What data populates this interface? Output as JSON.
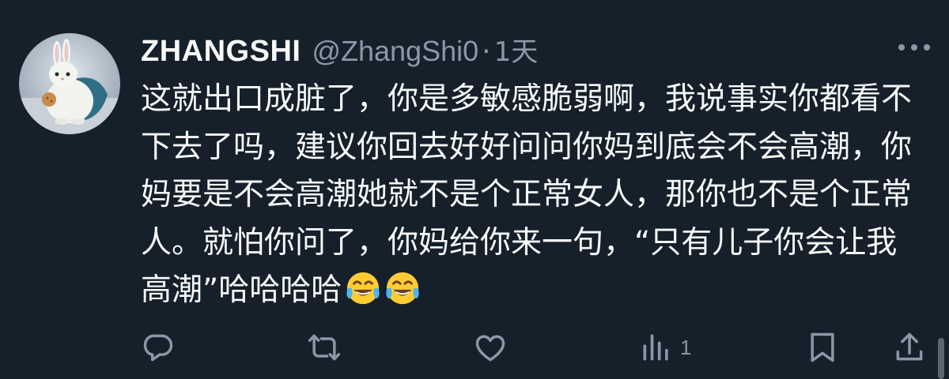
{
  "tweet": {
    "display_name": "ZHANGSHI",
    "handle": "@ZhangShi0",
    "separator": "·",
    "time": "1天",
    "text": "这就出口成脏了，你是多敏感脆弱啊，我说事实你都看不下去了吗，建议你回去好好问问你妈到底会不会高潮，你妈要是不会高潮她就不是个正常女人，那你也不是个正常人。就怕你问了，你妈给你来一句，“只有儿子你会让我高潮”哈哈哈哈",
    "emojis": [
      "face-with-tears-of-joy",
      "face-with-tears-of-joy"
    ],
    "actions": {
      "reply_icon": "reply-icon",
      "retweet_icon": "retweet-icon",
      "like_icon": "like-icon",
      "views_icon": "views-icon",
      "views_count": "1",
      "bookmark_icon": "bookmark-icon",
      "share_icon": "share-icon"
    }
  },
  "colors": {
    "background": "#15202b",
    "text": "#f7f9f9",
    "secondary": "#8b98a5"
  }
}
